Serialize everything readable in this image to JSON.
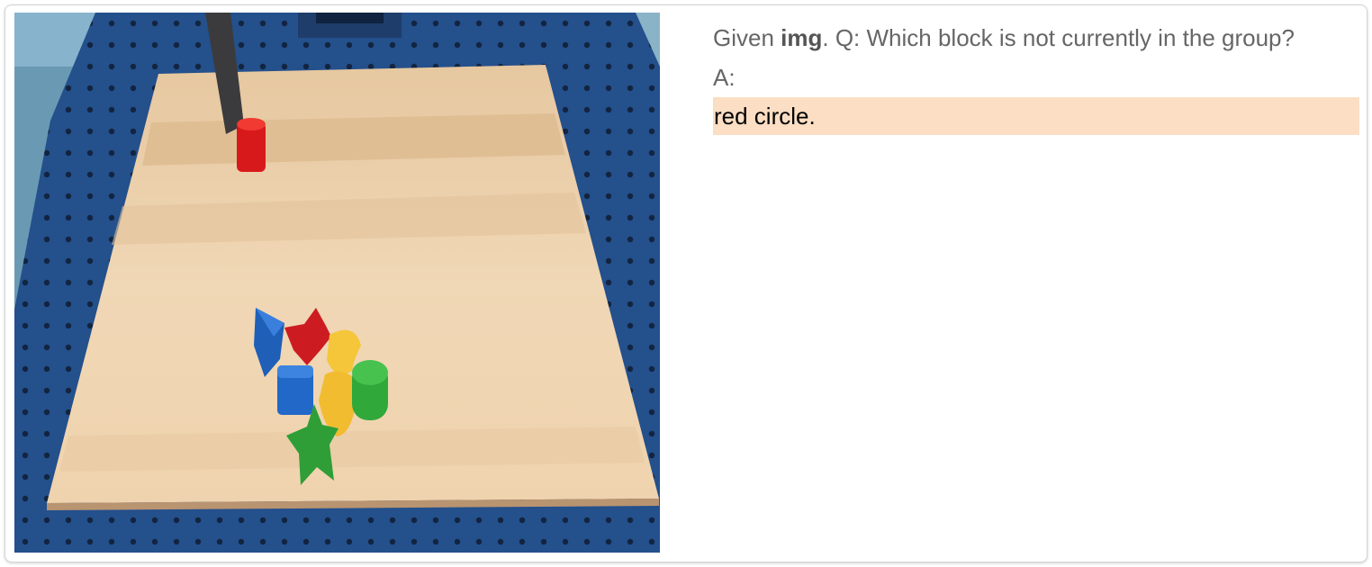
{
  "prompt": {
    "prefix": "Given",
    "image_token": "img",
    "question": ". Q: Which block is not currently in the group?",
    "answer_label": "A:"
  },
  "answer": "red circle.",
  "colors": {
    "answer_highlight": "#fbdec3",
    "question_text": "#666666",
    "answer_text": "#000000"
  }
}
